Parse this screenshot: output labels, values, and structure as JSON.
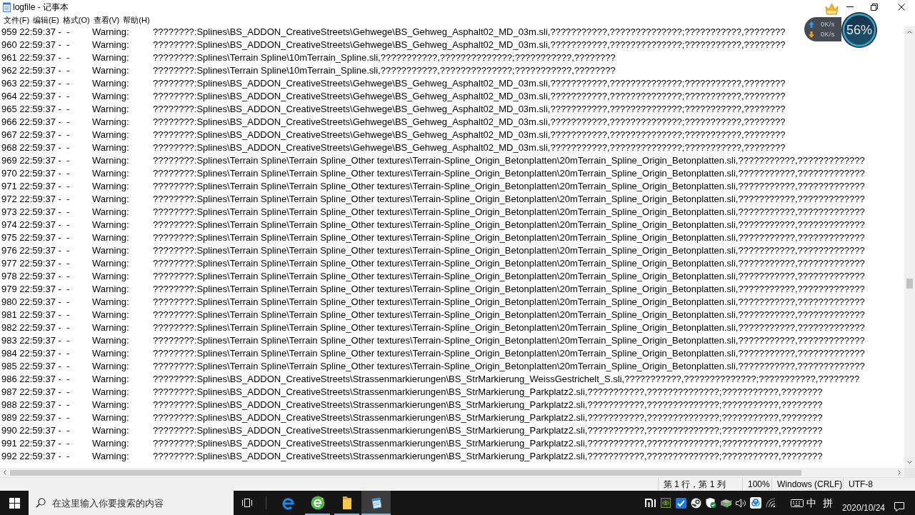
{
  "window": {
    "title": "logfile - 记事本"
  },
  "speed_widget": {
    "upload": "0K/s",
    "download": "0K/s",
    "memory": "56%"
  },
  "menu": [
    "文件(F)",
    "编辑(E)",
    "格式(O)",
    "查看(V)",
    "帮助(H)"
  ],
  "lines": [
    {
      "prefix": "959 22:59:37 -  -",
      "level": "Warning:",
      "message": "????????:Splines\\BS_ADDON_CreativeStreets\\Gehwege\\BS_Gehweg_Asphalt02_MD_03m.sli,???????????,??????????????;???????????,????????"
    },
    {
      "prefix": "960 22:59:37 -  -",
      "level": "Warning:",
      "message": "????????:Splines\\BS_ADDON_CreativeStreets\\Gehwege\\BS_Gehweg_Asphalt02_MD_03m.sli,???????????,??????????????;???????????,????????"
    },
    {
      "prefix": "961 22:59:37 -  -",
      "level": "Warning:",
      "message": "????????:Splines\\Terrain Spline\\10mTerrain_Spline.sli,???????????,??????????????;???????????,????????"
    },
    {
      "prefix": "962 22:59:37 -  -",
      "level": "Warning:",
      "message": "????????:Splines\\Terrain Spline\\10mTerrain_Spline.sli,???????????,??????????????;???????????,????????"
    },
    {
      "prefix": "963 22:59:37 -  -",
      "level": "Warning:",
      "message": "????????:Splines\\BS_ADDON_CreativeStreets\\Gehwege\\BS_Gehweg_Asphalt02_MD_03m.sli,???????????,??????????????;???????????,????????"
    },
    {
      "prefix": "964 22:59:37 -  -",
      "level": "Warning:",
      "message": "????????:Splines\\BS_ADDON_CreativeStreets\\Gehwege\\BS_Gehweg_Asphalt02_MD_03m.sli,???????????,??????????????;???????????,????????"
    },
    {
      "prefix": "965 22:59:37 -  -",
      "level": "Warning:",
      "message": "????????:Splines\\BS_ADDON_CreativeStreets\\Gehwege\\BS_Gehweg_Asphalt02_MD_03m.sli,???????????,??????????????;???????????,????????"
    },
    {
      "prefix": "966 22:59:37 -  -",
      "level": "Warning:",
      "message": "????????:Splines\\BS_ADDON_CreativeStreets\\Gehwege\\BS_Gehweg_Asphalt02_MD_03m.sli,???????????,??????????????;???????????,????????"
    },
    {
      "prefix": "967 22:59:37 -  -",
      "level": "Warning:",
      "message": "????????:Splines\\BS_ADDON_CreativeStreets\\Gehwege\\BS_Gehweg_Asphalt02_MD_03m.sli,???????????,??????????????;???????????,????????"
    },
    {
      "prefix": "968 22:59:37 -  -",
      "level": "Warning:",
      "message": "????????:Splines\\BS_ADDON_CreativeStreets\\Gehwege\\BS_Gehweg_Asphalt02_MD_03m.sli,???????????,??????????????;???????????,????????"
    },
    {
      "prefix": "969 22:59:37 -  -",
      "level": "Warning:",
      "message": "????????:Splines\\Terrain Spline\\Terrain Spline_Other textures\\Terrain-Spline_Origin_Betonplatten\\20mTerrain_Spline_Origin_Betonplatten.sli,???????????,?????????????"
    },
    {
      "prefix": "970 22:59:37 -  -",
      "level": "Warning:",
      "message": "????????:Splines\\Terrain Spline\\Terrain Spline_Other textures\\Terrain-Spline_Origin_Betonplatten\\20mTerrain_Spline_Origin_Betonplatten.sli,???????????,?????????????"
    },
    {
      "prefix": "971 22:59:37 -  -",
      "level": "Warning:",
      "message": "????????:Splines\\Terrain Spline\\Terrain Spline_Other textures\\Terrain-Spline_Origin_Betonplatten\\20mTerrain_Spline_Origin_Betonplatten.sli,???????????,?????????????"
    },
    {
      "prefix": "972 22:59:37 -  -",
      "level": "Warning:",
      "message": "????????:Splines\\Terrain Spline\\Terrain Spline_Other textures\\Terrain-Spline_Origin_Betonplatten\\20mTerrain_Spline_Origin_Betonplatten.sli,???????????,?????????????"
    },
    {
      "prefix": "973 22:59:37 -  -",
      "level": "Warning:",
      "message": "????????:Splines\\Terrain Spline\\Terrain Spline_Other textures\\Terrain-Spline_Origin_Betonplatten\\20mTerrain_Spline_Origin_Betonplatten.sli,???????????,?????????????"
    },
    {
      "prefix": "974 22:59:37 -  -",
      "level": "Warning:",
      "message": "????????:Splines\\Terrain Spline\\Terrain Spline_Other textures\\Terrain-Spline_Origin_Betonplatten\\20mTerrain_Spline_Origin_Betonplatten.sli,???????????,?????????????"
    },
    {
      "prefix": "975 22:59:37 -  -",
      "level": "Warning:",
      "message": "????????:Splines\\Terrain Spline\\Terrain Spline_Other textures\\Terrain-Spline_Origin_Betonplatten\\20mTerrain_Spline_Origin_Betonplatten.sli,???????????,?????????????"
    },
    {
      "prefix": "976 22:59:37 -  -",
      "level": "Warning:",
      "message": "????????:Splines\\Terrain Spline\\Terrain Spline_Other textures\\Terrain-Spline_Origin_Betonplatten\\20mTerrain_Spline_Origin_Betonplatten.sli,???????????,?????????????"
    },
    {
      "prefix": "977 22:59:37 -  -",
      "level": "Warning:",
      "message": "????????:Splines\\Terrain Spline\\Terrain Spline_Other textures\\Terrain-Spline_Origin_Betonplatten\\20mTerrain_Spline_Origin_Betonplatten.sli,???????????,?????????????"
    },
    {
      "prefix": "978 22:59:37 -  -",
      "level": "Warning:",
      "message": "????????:Splines\\Terrain Spline\\Terrain Spline_Other textures\\Terrain-Spline_Origin_Betonplatten\\20mTerrain_Spline_Origin_Betonplatten.sli,???????????,?????????????"
    },
    {
      "prefix": "979 22:59:37 -  -",
      "level": "Warning:",
      "message": "????????:Splines\\Terrain Spline\\Terrain Spline_Other textures\\Terrain-Spline_Origin_Betonplatten\\20mTerrain_Spline_Origin_Betonplatten.sli,???????????,?????????????"
    },
    {
      "prefix": "980 22:59:37 -  -",
      "level": "Warning:",
      "message": "????????:Splines\\Terrain Spline\\Terrain Spline_Other textures\\Terrain-Spline_Origin_Betonplatten\\20mTerrain_Spline_Origin_Betonplatten.sli,???????????,?????????????"
    },
    {
      "prefix": "981 22:59:37 -  -",
      "level": "Warning:",
      "message": "????????:Splines\\Terrain Spline\\Terrain Spline_Other textures\\Terrain-Spline_Origin_Betonplatten\\20mTerrain_Spline_Origin_Betonplatten.sli,???????????,?????????????"
    },
    {
      "prefix": "982 22:59:37 -  -",
      "level": "Warning:",
      "message": "????????:Splines\\Terrain Spline\\Terrain Spline_Other textures\\Terrain-Spline_Origin_Betonplatten\\20mTerrain_Spline_Origin_Betonplatten.sli,???????????,?????????????"
    },
    {
      "prefix": "983 22:59:37 -  -",
      "level": "Warning:",
      "message": "????????:Splines\\Terrain Spline\\Terrain Spline_Other textures\\Terrain-Spline_Origin_Betonplatten\\20mTerrain_Spline_Origin_Betonplatten.sli,???????????,?????????????"
    },
    {
      "prefix": "984 22:59:37 -  -",
      "level": "Warning:",
      "message": "????????:Splines\\Terrain Spline\\Terrain Spline_Other textures\\Terrain-Spline_Origin_Betonplatten\\20mTerrain_Spline_Origin_Betonplatten.sli,???????????,?????????????"
    },
    {
      "prefix": "985 22:59:37 -  -",
      "level": "Warning:",
      "message": "????????:Splines\\Terrain Spline\\Terrain Spline_Other textures\\Terrain-Spline_Origin_Betonplatten\\20mTerrain_Spline_Origin_Betonplatten.sli,???????????,?????????????"
    },
    {
      "prefix": "986 22:59:37 -  -",
      "level": "Warning:",
      "message": "????????:Splines\\BS_ADDON_CreativeStreets\\Strassenmarkierungen\\BS_StrMarkierung_WeissGestrichelt_S.sli,???????????,??????????????;???????????,????????"
    },
    {
      "prefix": "987 22:59:37 -  -",
      "level": "Warning:",
      "message": "????????:Splines\\BS_ADDON_CreativeStreets\\Strassenmarkierungen\\BS_StrMarkierung_Parkplatz2.sli,???????????,??????????????;???????????,????????"
    },
    {
      "prefix": "988 22:59:37 -  -",
      "level": "Warning:",
      "message": "????????:Splines\\BS_ADDON_CreativeStreets\\Strassenmarkierungen\\BS_StrMarkierung_Parkplatz2.sli,???????????,??????????????;???????????,????????"
    },
    {
      "prefix": "989 22:59:37 -  -",
      "level": "Warning:",
      "message": "????????:Splines\\BS_ADDON_CreativeStreets\\Strassenmarkierungen\\BS_StrMarkierung_Parkplatz2.sli,???????????,??????????????;???????????,????????"
    },
    {
      "prefix": "990 22:59:37 -  -",
      "level": "Warning:",
      "message": "????????:Splines\\BS_ADDON_CreativeStreets\\Strassenmarkierungen\\BS_StrMarkierung_Parkplatz2.sli,???????????,??????????????;???????????,????????"
    },
    {
      "prefix": "991 22:59:37 -  -",
      "level": "Warning:",
      "message": "????????:Splines\\BS_ADDON_CreativeStreets\\Strassenmarkierungen\\BS_StrMarkierung_Parkplatz2.sli,???????????,??????????????;???????????,????????"
    },
    {
      "prefix": "992 22:59:37 -  -",
      "level": "Warning:",
      "message": "????????:Splines\\BS_ADDON_CreativeStreets\\Strassenmarkierungen\\BS_StrMarkierung_Parkplatz2.sli,???????????,??????????????;???????????,????????"
    }
  ],
  "status_bar": {
    "position": "第 1 行，第 1 列",
    "zoom": "100%",
    "line_ending": "Windows (CRLF)",
    "encoding": "UTF-8"
  },
  "taskbar": {
    "search": {
      "placeholder": "在这里输入你要搜索的内容"
    },
    "apps": [
      {
        "kind": "edge",
        "running": false,
        "selected": false
      },
      {
        "kind": "browser",
        "running": true,
        "selected": false
      },
      {
        "kind": "folder",
        "running": true,
        "selected": false
      },
      {
        "kind": "notepad",
        "running": true,
        "selected": true
      }
    ],
    "tray": {
      "input_mode": "中",
      "ime": "拼",
      "date": "2020/10/24"
    }
  }
}
